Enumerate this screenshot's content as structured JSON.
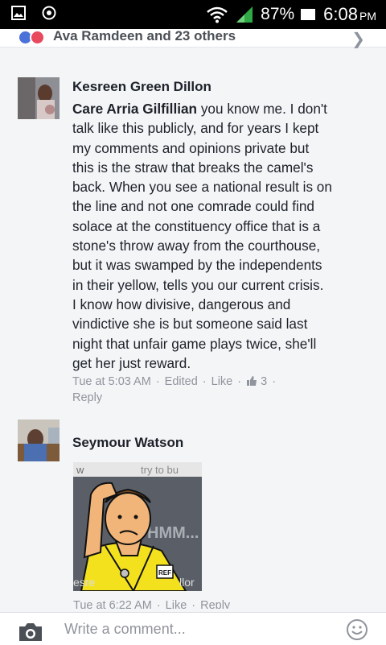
{
  "status_bar": {
    "battery": "87%",
    "time": "6:08",
    "ampm": "PM",
    "icons": [
      "gallery-icon",
      "circle-settings-icon",
      "wifi-icon",
      "signal-icon",
      "battery-icon"
    ]
  },
  "reactions": {
    "summary": "Ava Ramdeen and 23 others",
    "icons": [
      "like-reaction-icon",
      "love-reaction-icon"
    ]
  },
  "comments": [
    {
      "author": "Kesreen Green Dillon",
      "mention": "Care Arria Gilfillian",
      "lines": [
        " you know me. I don't",
        "talk like this publicly, and for years I kept",
        "my comments and opinions private but",
        "this is the straw that breaks the camel's",
        "back. When you see a national result is on",
        "the line and not one comrade could find",
        "solace at the constituency office that is a",
        "stone's throw away from the courthouse,",
        "but it was swamped by the independents",
        "in their yellow, tells you our current crisis.",
        "I know how divisive, dangerous and",
        "vindictive she is but someone said last",
        "night that unfair game plays twice, she'll",
        "get her just reward."
      ],
      "time": "Tue at 5:03 AM",
      "edited": "Edited",
      "like": "Like",
      "like_count": "3",
      "reply": "Reply"
    },
    {
      "author": "Seymour Watson",
      "image_caption_top": "w",
      "image_caption_top2": "try to bu",
      "image_text_hmm": "HMM...",
      "image_caption_bottom_left": "esre",
      "image_caption_bottom_right": "llor",
      "badge": "REF",
      "time": "Tue at 6:22 AM",
      "like": "Like",
      "reply": "Reply"
    }
  ],
  "composer": {
    "placeholder": "Write a comment...",
    "icons": [
      "camera-icon",
      "emoji-icon"
    ]
  }
}
